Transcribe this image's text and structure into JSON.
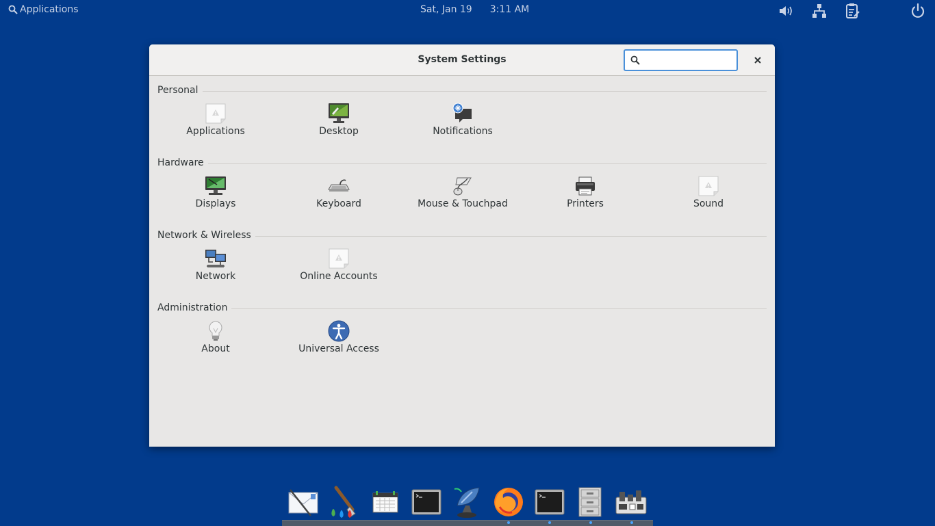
{
  "top_panel": {
    "applications_label": "Applications",
    "date": "Sat, Jan 19",
    "time": "3:11 AM",
    "tray": [
      {
        "name": "volume-icon"
      },
      {
        "name": "network-icon"
      },
      {
        "name": "clipboard-icon"
      },
      {
        "name": "power-icon"
      }
    ]
  },
  "window": {
    "title": "System Settings",
    "search": {
      "value": "",
      "placeholder": ""
    },
    "close_label": "×"
  },
  "categories": [
    {
      "title": "Personal",
      "items": [
        {
          "label": "Applications",
          "icon": "missing-image-icon"
        },
        {
          "label": "Desktop",
          "icon": "desktop-icon"
        },
        {
          "label": "Notifications",
          "icon": "notifications-icon"
        }
      ]
    },
    {
      "title": "Hardware",
      "items": [
        {
          "label": "Displays",
          "icon": "displays-icon"
        },
        {
          "label": "Keyboard",
          "icon": "keyboard-icon"
        },
        {
          "label": "Mouse & Touchpad",
          "icon": "mouse-icon"
        },
        {
          "label": "Printers",
          "icon": "printer-icon"
        },
        {
          "label": "Sound",
          "icon": "missing-image-icon"
        }
      ]
    },
    {
      "title": "Network & Wireless",
      "items": [
        {
          "label": "Network",
          "icon": "network-computers-icon"
        },
        {
          "label": "Online Accounts",
          "icon": "missing-image-icon"
        }
      ]
    },
    {
      "title": "Administration",
      "items": [
        {
          "label": "About",
          "icon": "lightbulb-icon"
        },
        {
          "label": "Universal Access",
          "icon": "accessibility-icon"
        }
      ]
    }
  ],
  "dock": [
    {
      "name": "mail-icon"
    },
    {
      "name": "paint-brush-icon"
    },
    {
      "name": "calendar-icon"
    },
    {
      "name": "terminal-icon"
    },
    {
      "name": "satellite-icon"
    },
    {
      "name": "firefox-icon"
    },
    {
      "name": "terminal-icon"
    },
    {
      "name": "file-cabinet-icon"
    },
    {
      "name": "system-settings-icon"
    }
  ],
  "colors": {
    "desktop": "#023b8c",
    "accent": "#4a90d9",
    "window": "#e8e7e6"
  }
}
